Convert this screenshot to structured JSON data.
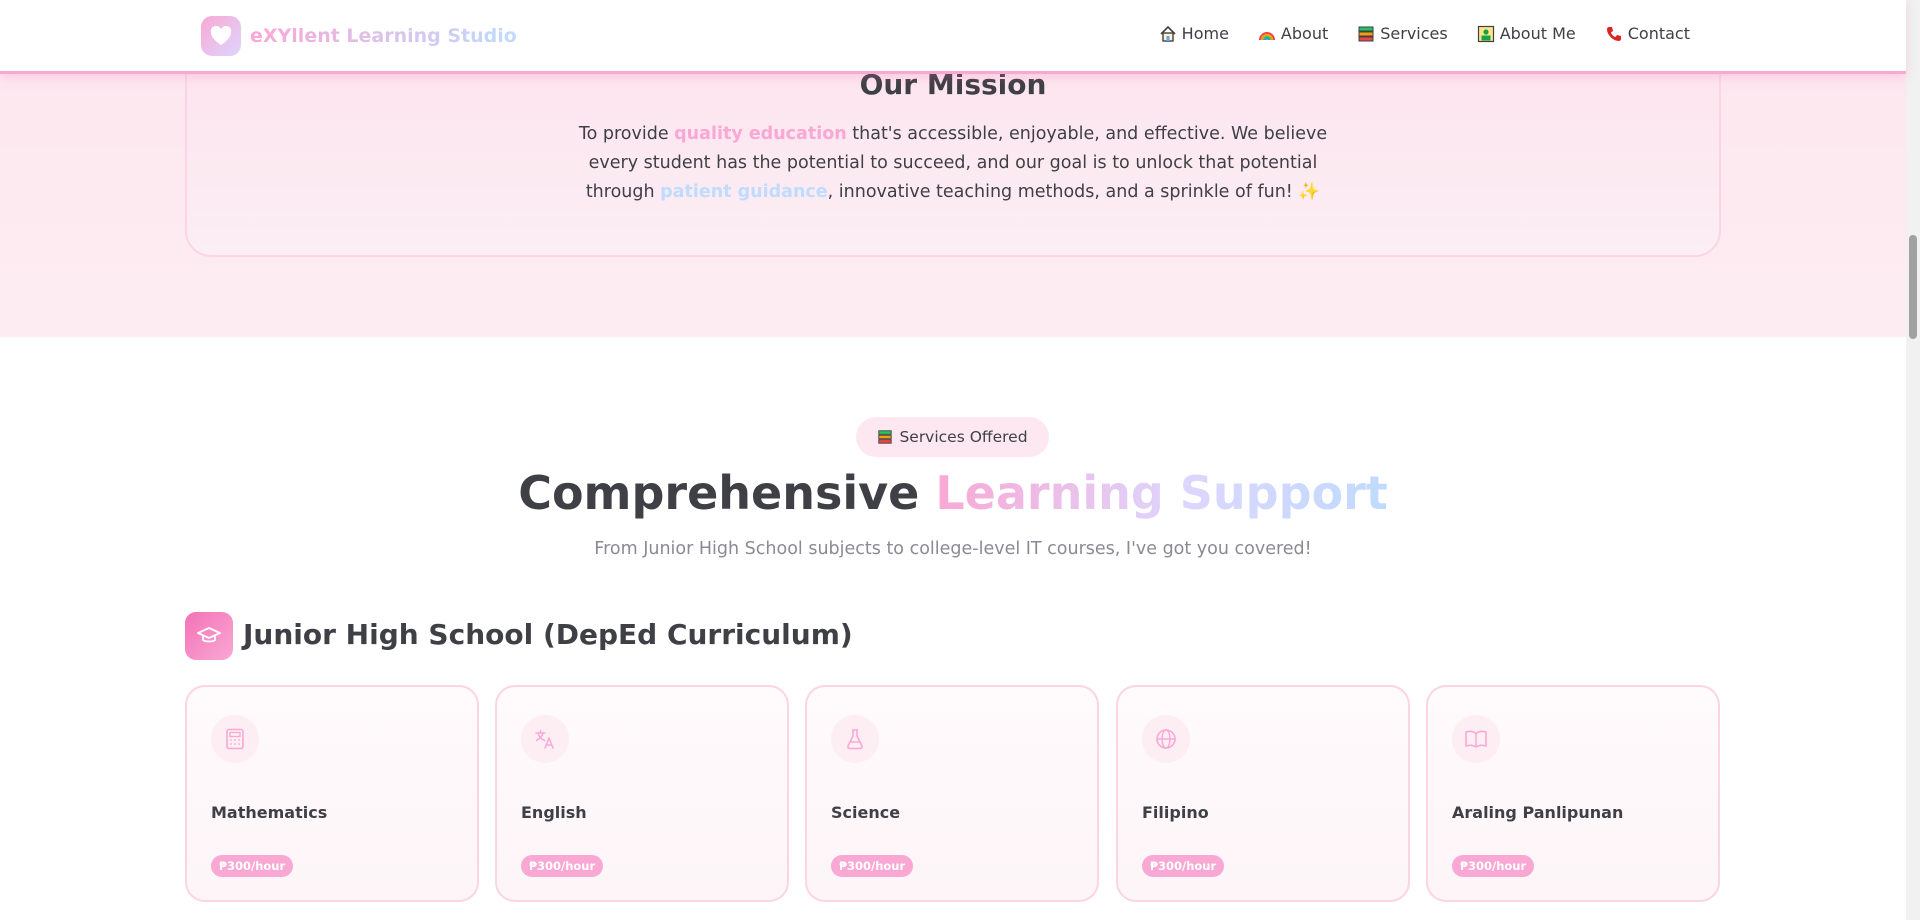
{
  "brand": {
    "name": "eXYllent Learning Studio",
    "logo_icon": "heart-icon"
  },
  "nav": {
    "items": [
      {
        "label": "Home",
        "icon": "house-icon"
      },
      {
        "label": "About",
        "icon": "rainbow-icon"
      },
      {
        "label": "Services",
        "icon": "books-icon"
      },
      {
        "label": "About Me",
        "icon": "portrait-icon"
      },
      {
        "label": "Contact",
        "icon": "phone-icon"
      }
    ]
  },
  "mission": {
    "title": "Our Mission",
    "text_1": "To provide ",
    "highlight_1": "quality education",
    "text_2": " that's accessible, enjoyable, and effective. We believe every student has the potential to succeed, and our goal is to unlock that potential through ",
    "highlight_2": "patient guidance",
    "text_3": ", innovative teaching methods, and a sprinkle of fun! ",
    "emoji": "✨"
  },
  "services": {
    "badge": "Services Offered",
    "badge_icon": "books-icon",
    "heading_plain": "Comprehensive ",
    "heading_gradient": "Learning Support",
    "subtitle": "From Junior High School subjects to college-level IT courses, I've got you covered!",
    "category": {
      "title": "Junior High School (DepEd Curriculum)",
      "icon": "graduation-cap-icon",
      "subjects": [
        {
          "name": "Mathematics",
          "price": "₱300/hour",
          "icon": "calculator-icon"
        },
        {
          "name": "English",
          "price": "₱300/hour",
          "icon": "translate-icon"
        },
        {
          "name": "Science",
          "price": "₱300/hour",
          "icon": "flask-icon"
        },
        {
          "name": "Filipino",
          "price": "₱300/hour",
          "icon": "globe-icon"
        },
        {
          "name": "Araling Panlipunan",
          "price": "₱300/hour",
          "icon": "book-open-icon"
        }
      ]
    }
  },
  "colors": {
    "pink": "#f9a8d4",
    "hot_pink": "#f472b6",
    "lavender": "#ddd6fe",
    "light_blue": "#bfdbfe",
    "text": "#3f3f46",
    "muted": "#8a8a94",
    "band_bg": "#fde7ef"
  }
}
